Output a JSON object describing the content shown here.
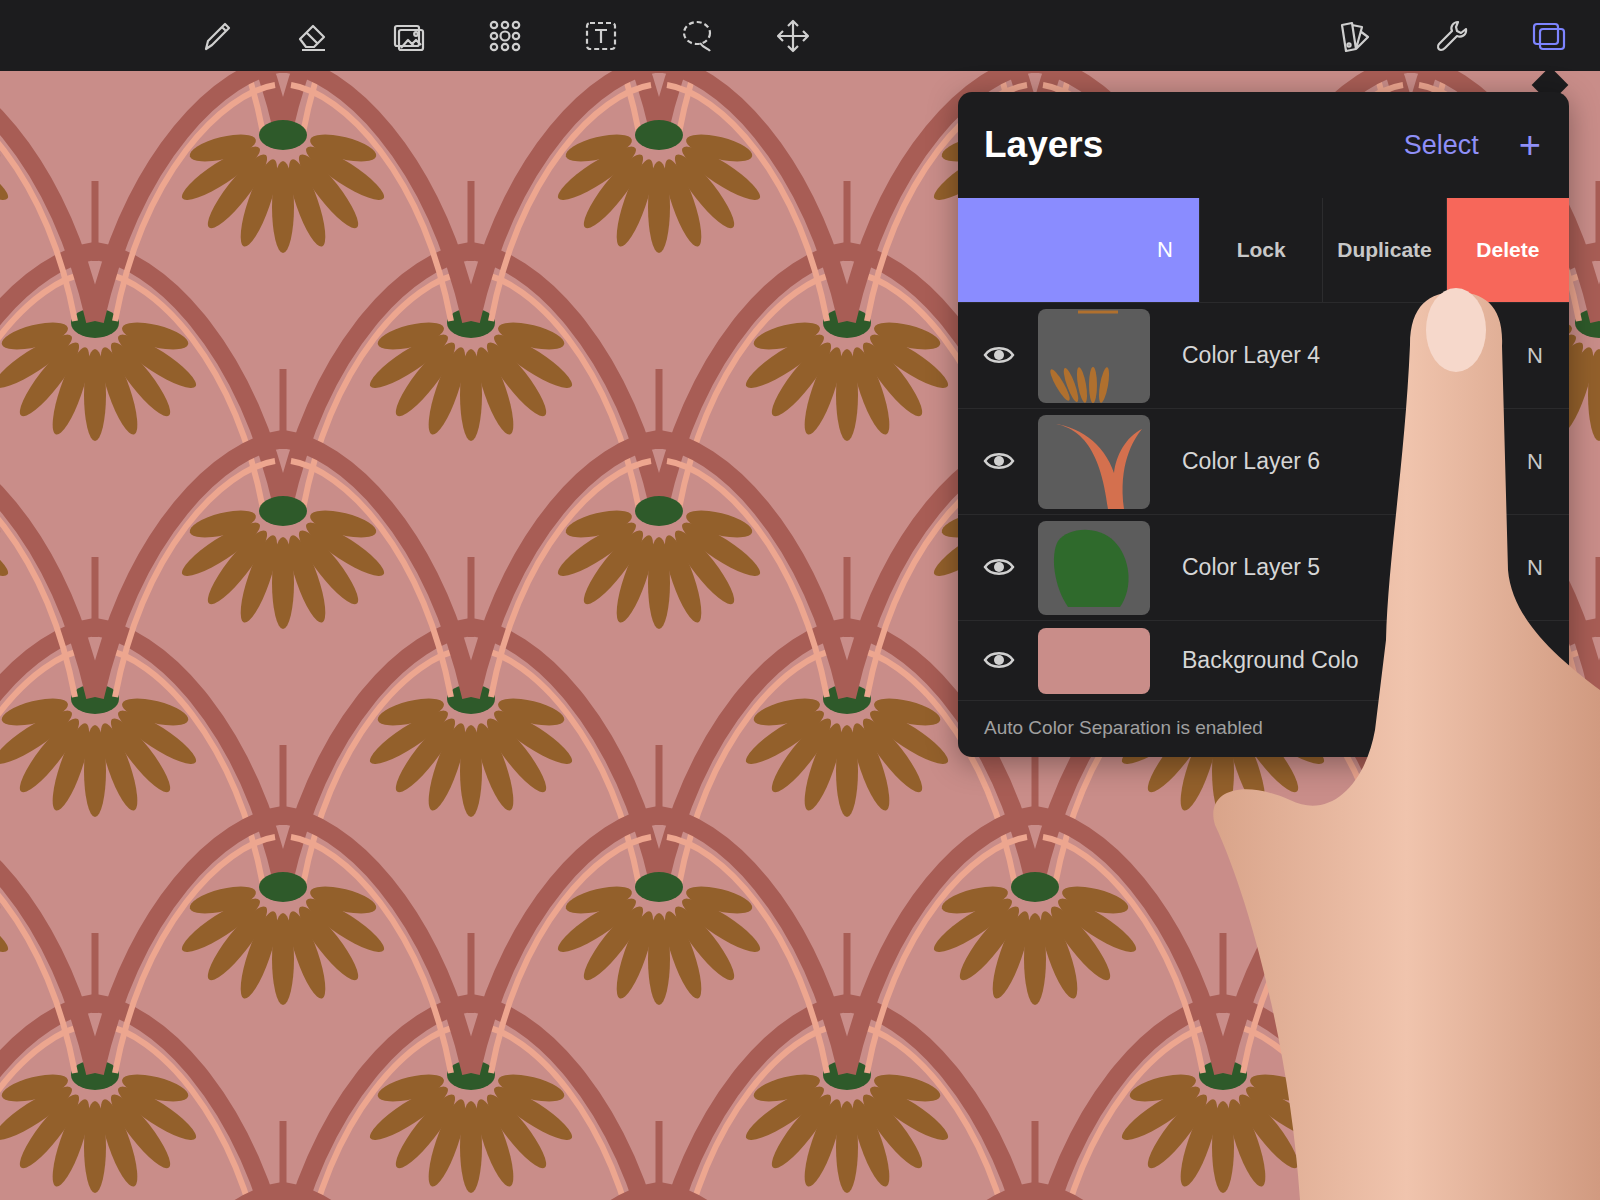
{
  "toolbar": {
    "tools": [
      {
        "selected": false
      },
      {
        "selected": false
      },
      {
        "selected": false
      },
      {
        "selected": false
      },
      {
        "selected": false
      },
      {
        "selected": false
      },
      {
        "selected": false
      }
    ],
    "actions": [
      {
        "selected": false
      },
      {
        "selected": false
      },
      {
        "selected": true
      }
    ]
  },
  "panel": {
    "title": "Layers",
    "select": "Select",
    "add": "+"
  },
  "swiped_layer": {
    "blend": "N",
    "selected": true,
    "actions": [
      {
        "label": "Lock",
        "kind": "plain"
      },
      {
        "label": "Duplicate",
        "kind": "plain"
      },
      {
        "label": "Delete",
        "kind": "destructive"
      }
    ]
  },
  "layers": [
    {
      "name": "Color Layer 4",
      "visible": true,
      "blend": "N",
      "kind": "petals",
      "color": "#b0702e"
    },
    {
      "name": "Color Layer 6",
      "visible": true,
      "blend": "N",
      "kind": "leaf",
      "color": "#d4704e"
    },
    {
      "name": "Color Layer 5",
      "visible": true,
      "blend": "N",
      "kind": "blob",
      "color": "#2f6a2c"
    },
    {
      "name": "Background Colo",
      "visible": true,
      "blend": "",
      "kind": "solid",
      "color": "#c98d89"
    }
  ],
  "footer": "Auto Color Separation is enabled"
}
